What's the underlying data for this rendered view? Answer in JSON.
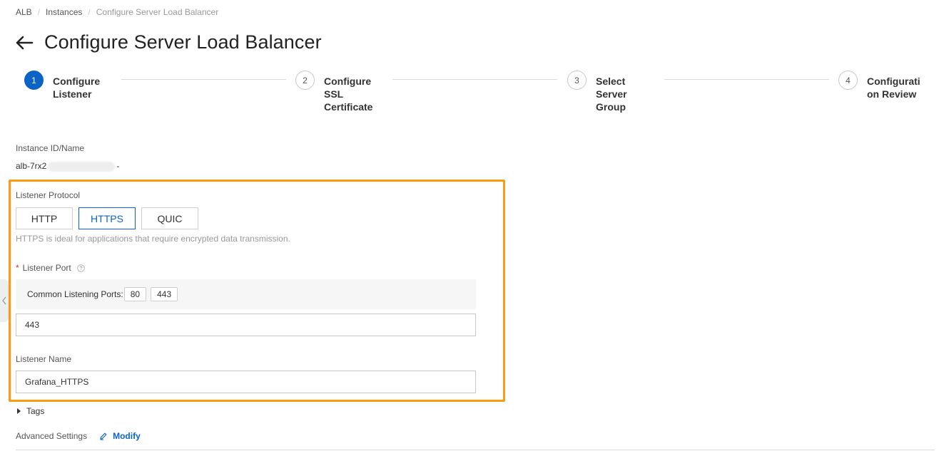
{
  "breadcrumb": [
    "ALB",
    "Instances",
    "Configure Server Load Balancer"
  ],
  "page_title": "Configure Server Load Balancer",
  "steps": [
    {
      "number": "1",
      "label_line1": "Configure",
      "label_line2": "Listener",
      "label_line3": ""
    },
    {
      "number": "2",
      "label_line1": "Configure",
      "label_line2": "SSL",
      "label_line3": "Certificate"
    },
    {
      "number": "3",
      "label_line1": "Select",
      "label_line2": "Server",
      "label_line3": "Group"
    },
    {
      "number": "4",
      "label_line1": "Configurati",
      "label_line2": "on Review",
      "label_line3": ""
    }
  ],
  "instance": {
    "label": "Instance ID/Name",
    "id_prefix": "alb-7rx2",
    "name_suffix": "-"
  },
  "listener_protocol": {
    "label": "Listener Protocol",
    "options": [
      "HTTP",
      "HTTPS",
      "QUIC"
    ],
    "selected": "HTTPS",
    "hint": "HTTPS is ideal for applications that require encrypted data transmission."
  },
  "listener_port": {
    "required_mark": "*",
    "label": "Listener Port",
    "common_ports_label": "Common Listening Ports:",
    "common_ports": [
      "80",
      "443"
    ],
    "value": "443"
  },
  "listener_name": {
    "label": "Listener Name",
    "value": "Grafana_HTTPS"
  },
  "tags": {
    "label": "Tags"
  },
  "advanced_settings": {
    "label": "Advanced Settings",
    "modify_label": "Modify"
  },
  "colors": {
    "accent": "#0b63c5",
    "highlight": "#ff9a10",
    "required": "#d93026"
  }
}
